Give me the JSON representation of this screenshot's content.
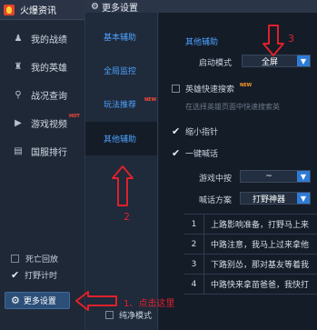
{
  "sidebar": {
    "app_title": "火爆资讯",
    "items": [
      {
        "label": "我的战绩",
        "icon": "person-icon"
      },
      {
        "label": "我的英雄",
        "icon": "hero-icon"
      },
      {
        "label": "战况查询",
        "icon": "search-icon"
      },
      {
        "label": "游戏视频",
        "icon": "play-icon",
        "badge": "HOT"
      },
      {
        "label": "国服排行",
        "icon": "bar-chart-icon"
      }
    ],
    "options": [
      {
        "label": "死亡回放",
        "checked": false
      },
      {
        "label": "打野计时",
        "checked": true
      }
    ],
    "more_settings_label": "更多设置"
  },
  "header": {
    "title": "更多设置"
  },
  "tabs": [
    {
      "label": "基本辅助",
      "active": false
    },
    {
      "label": "全局监控",
      "active": false
    },
    {
      "label": "玩法推荐",
      "active": false,
      "badge": "NEW"
    },
    {
      "label": "其他辅助",
      "active": true
    }
  ],
  "panel": {
    "section_title": "其他辅助",
    "start_mode_label": "启动模式",
    "start_mode_value": "全屏",
    "hero_quick_search_label": "英雄快速搜索",
    "hero_quick_search_badge": "NEW",
    "hero_quick_search_checked": false,
    "hint": "在选择英雄页面中快速搜索英",
    "minimap_label": "缩小指针",
    "minimap_checked": true,
    "quick_shout_label": "一键喊话",
    "quick_shout_checked": true,
    "game_middle_label": "游戏中按",
    "game_middle_value": "~",
    "shout_scheme_label": "喊话方案",
    "shout_scheme_value": "打野神器",
    "shout_rows": [
      {
        "n": "1",
        "text": "上路影响准备，打野马上来"
      },
      {
        "n": "2",
        "text": "中路注意，我马上过来拿他"
      },
      {
        "n": "3",
        "text": "下路别怂，那对基友等着我"
      },
      {
        "n": "4",
        "text": "中路快来拿苗爸爸，我快打"
      }
    ],
    "pure_mode_label": "纯净模式",
    "pure_mode_checked": false
  },
  "annotations": {
    "step1": "1、点击这里",
    "step2": "2",
    "step3": "3",
    "color": "#e0202a"
  }
}
